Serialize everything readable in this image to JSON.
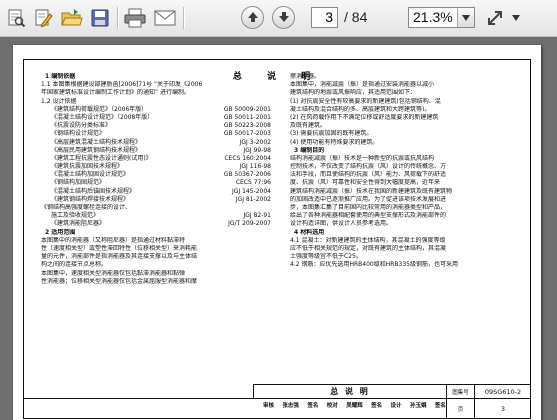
{
  "toolbar": {
    "icons": [
      "print-preview-icon",
      "edit-document-icon",
      "open-folder-icon",
      "save-icon",
      "print-icon",
      "email-icon",
      "previous-page-icon",
      "next-page-icon",
      "fit-page-icon"
    ],
    "page_current": "3",
    "page_total": "/ 84",
    "zoom": "21.3%"
  },
  "document": {
    "title": "总 说 明",
    "left_column": [
      {
        "type": "heading",
        "text": "1    编制依据"
      },
      {
        "type": "text",
        "text": "1.1  本图集根据建设部建质函[2006]71号 “关于印发《2006"
      },
      {
        "type": "text",
        "text": "年国家建筑标准设计编制工作计划》的通知” 进行编制。"
      },
      {
        "type": "text",
        "text": "1.2  设计依据"
      },
      {
        "type": "std",
        "name": "《建筑结构荷载规范》（2006年版）",
        "code": "GB 50009-2001"
      },
      {
        "type": "std",
        "name": "《混凝土结构设计规范》（2008年版）",
        "code": "GB 50011-2001"
      },
      {
        "type": "std",
        "name": "《抗震设防分类标准》",
        "code": "GB 50223-2008"
      },
      {
        "type": "std",
        "name": "《钢结构设计规范》",
        "code": "GB 50017-2003"
      },
      {
        "type": "std",
        "name": "《高层建筑混凝土结构技术规程》",
        "code": "JGJ 3-2002"
      },
      {
        "type": "std",
        "name": "《高层民用建筑钢结构技术规程》",
        "code": "JGJ 99-98"
      },
      {
        "type": "std",
        "name": "《建筑工程抗震性态设计通则(试用)》",
        "code": "CECS 160:2004"
      },
      {
        "type": "std",
        "name": "《建筑抗震加固技术规程》",
        "code": "JGJ 116-98"
      },
      {
        "type": "std",
        "name": "《混凝土结构加固设计规范》",
        "code": "GB 50367-2006"
      },
      {
        "type": "std",
        "name": "《钢结构加固规范》",
        "code": "CECS 77:96"
      },
      {
        "type": "std",
        "name": "《混凝土结构后锚固技术规程》",
        "code": "JGJ 145-2004"
      },
      {
        "type": "std",
        "name": "《建筑钢结构焊接技术规程》",
        "code": "JGJ 81-2002"
      },
      {
        "type": "text",
        "text": "《钢结构高强度螺栓连接的设计、"
      },
      {
        "type": "std",
        "name": "施工及验收规范》",
        "code": "JGJ 82-91"
      },
      {
        "type": "std",
        "name": "《建筑消能阻尼器》",
        "code": "JG/T 209-2007"
      },
      {
        "type": "heading",
        "text": "2    适用范围"
      },
      {
        "type": "text",
        "text": "   本图集中的消能器（又称阻尼器）是指通过材料黏滞特"
      },
      {
        "type": "text",
        "text": "性（速度相关型）或塑性滞回特性（位移相关型）来消耗能"
      },
      {
        "type": "text",
        "text": "量的元件，消能部件是指消能器及其连接支撑以及与主体结"
      },
      {
        "type": "text",
        "text": "构之间的连接节点总称。"
      },
      {
        "type": "text",
        "text": "   本图集中，速度相关型消能器仅包括黏滞消能器和黏弹"
      },
      {
        "type": "text",
        "text": "性消能器；位移相关型消能器仅包括金属屈服型消能器和摩"
      }
    ],
    "right_column": [
      {
        "type": "text",
        "text": "擦消能器。"
      },
      {
        "type": "text",
        "text": "   本图集中，消能减震（振）是指通过安装消能器以减小"
      },
      {
        "type": "text",
        "text": "建筑结构的地震或风振响应，其适用范围如下："
      },
      {
        "type": "text",
        "text": "   (1) 对抗震安全性有较高要求的新建建筑(包括钢结构、混"
      },
      {
        "type": "text",
        "text": "凝土结构及混合结构的多、高层建筑和大跨建筑等)。"
      },
      {
        "type": "text",
        "text": "   (2) 在风荷载作用下不满足位移或舒适度要求的新建建筑"
      },
      {
        "type": "text",
        "text": "及既有建筑。"
      },
      {
        "type": "text",
        "text": "   (3) 需要抗震加固的既有建筑。"
      },
      {
        "type": "text",
        "text": "   (4) 使用功能有特殊要求的建筑。"
      },
      {
        "type": "heading",
        "text": "3    编制目的"
      },
      {
        "type": "text",
        "text": "   结构消能减震（振）技术是一种新型的抗震或抗风结构"
      },
      {
        "type": "text",
        "text": "控制技术，不仅改变了结构抗震（风）设计的传统概念、方"
      },
      {
        "type": "text",
        "text": "法和手段，而且使结构的抗震（风）能力、风荷载下的舒适"
      },
      {
        "type": "text",
        "text": "度、抗震（风）可靠性和安全性得到大幅度提高，近年来"
      },
      {
        "type": "text",
        "text": "建筑结构消能减震（振）技术在我国的新建建筑及既有建筑物"
      },
      {
        "type": "text",
        "text": "的加固改造中已逐渐推广应用。为了促进该项技术发展和进"
      },
      {
        "type": "text",
        "text": "步，本图集汇集了目前国内比较常用的消能器类型和产品，"
      },
      {
        "type": "text",
        "text": "给出了各种消能器相配套使用的典型支撑形式及消能部件的"
      },
      {
        "type": "text",
        "text": "设计构造详图，供设计人员参考选用。"
      },
      {
        "type": "heading",
        "text": "4    材料选用"
      },
      {
        "type": "text",
        "text": "4.1  混凝土：对新建建筑的主体结构，其混凝土的强度等级"
      },
      {
        "type": "text",
        "text": "应不低于相关规范的规定，对既有建筑的主体结构，其混凝"
      },
      {
        "type": "text",
        "text": "土强度等级宜不低于C25。"
      },
      {
        "type": "text",
        "text": "4.2  钢筋：应优先选用HRB400级和HRB335级钢筋，也可采用"
      }
    ],
    "title_block": {
      "main": "总 说 明",
      "atlas_label": "图集号",
      "atlas_no": "09SG610-2",
      "sign_row": [
        "审核",
        "张志强",
        "签名",
        "校对",
        "吴耀辉",
        "签名",
        "设计",
        "孙玉娟",
        "签名"
      ],
      "page_label": "页",
      "page_no": "3"
    }
  }
}
